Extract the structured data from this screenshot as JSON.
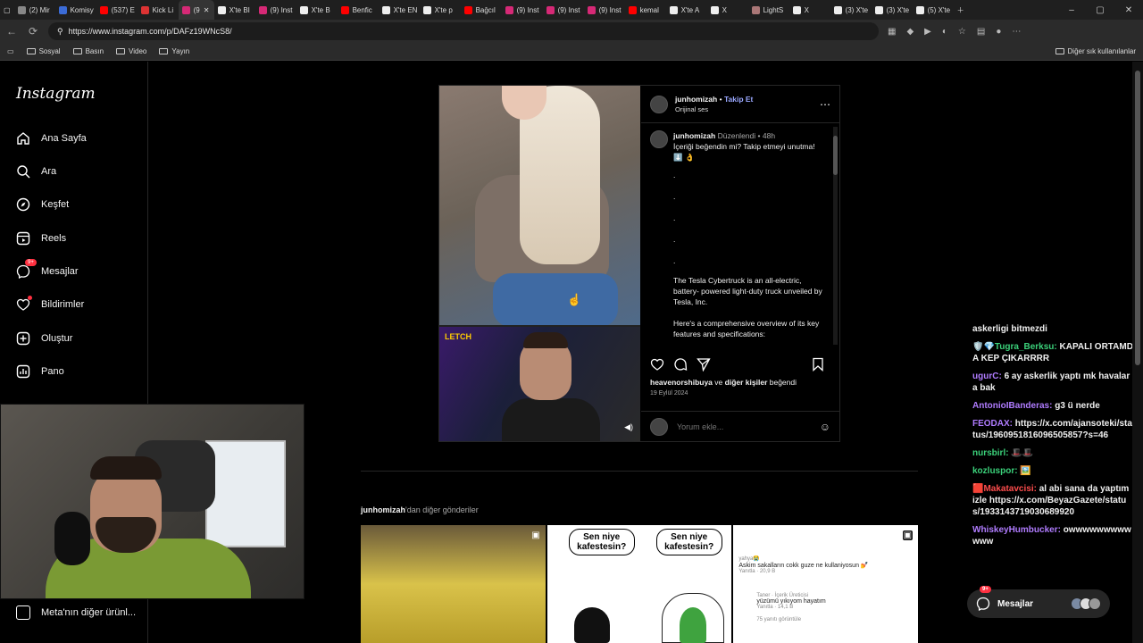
{
  "browser": {
    "tabs": [
      {
        "title": "(2) Mir",
        "color": "#888"
      },
      {
        "title": "Komisy",
        "color": "#3b6bd6"
      },
      {
        "title": "(537) E",
        "color": "#ff0000"
      },
      {
        "title": "Kick Li",
        "color": "#d33"
      },
      {
        "title": "(9",
        "color": "#d62976",
        "active": true
      },
      {
        "title": "X'te BI",
        "color": "#eee"
      },
      {
        "title": "(9) Inst",
        "color": "#d62976"
      },
      {
        "title": "X'te B",
        "color": "#eee"
      },
      {
        "title": "Benfic",
        "color": "#ff0000"
      },
      {
        "title": "X'te EN",
        "color": "#eee"
      },
      {
        "title": "X'te p",
        "color": "#eee"
      },
      {
        "title": "Bağcıl",
        "color": "#ff0000"
      },
      {
        "title": "(9) Inst",
        "color": "#d62976"
      },
      {
        "title": "(9) Inst",
        "color": "#d62976"
      },
      {
        "title": "(9) Inst",
        "color": "#d62976"
      },
      {
        "title": "kemal",
        "color": "#ff0000"
      },
      {
        "title": "X'te A",
        "color": "#eee"
      },
      {
        "title": "X",
        "color": "#eee"
      },
      {
        "title": "LightS",
        "color": "#a77"
      },
      {
        "title": "X",
        "color": "#eee"
      },
      {
        "title": "(3) X'te",
        "color": "#eee"
      },
      {
        "title": "(3) X'te",
        "color": "#eee"
      },
      {
        "title": "(5) X'te",
        "color": "#eee"
      }
    ],
    "url": "https://www.instagram.com/p/DAFz19WNcS8/",
    "bookmarks": [
      "Sosyal",
      "Basın",
      "Video",
      "Yayın"
    ],
    "bookmarks_right": "Diğer sık kullanılanlar"
  },
  "sidebar": {
    "logo": "Instagram",
    "items": [
      {
        "label": "Ana Sayfa",
        "icon": "home-icon"
      },
      {
        "label": "Ara",
        "icon": "search-icon"
      },
      {
        "label": "Keşfet",
        "icon": "compass-icon"
      },
      {
        "label": "Reels",
        "icon": "reels-icon"
      },
      {
        "label": "Mesajlar",
        "icon": "messenger-icon",
        "badge": "9+"
      },
      {
        "label": "Bildirimler",
        "icon": "heart-icon"
      },
      {
        "label": "Oluştur",
        "icon": "plus-square-icon"
      },
      {
        "label": "Pano",
        "icon": "dashboard-icon"
      }
    ],
    "meta_link": "Meta'nın diğer ürünl..."
  },
  "post": {
    "username": "junhomizah",
    "follow": "Takip Et",
    "audio": "Orijinal ses",
    "caption_meta_edited": "Düzenlendi",
    "caption_meta_age": "48h",
    "caption_text": "İçeriği beğendin mi? Takip etmeyi unutma! ⬇️ 👌",
    "dots": [
      ".",
      ".",
      ".",
      ".",
      "."
    ],
    "caption_p1": "The Tesla Cybertruck is an all-electric, battery- powered light-duty truck unveiled by Tesla, Inc.",
    "caption_p2": "Here's a comprehensive overview of its key features and specifications:",
    "likes_user": "heavenorshibuya",
    "likes_and": "ve",
    "likes_others": "diğer kişiler",
    "likes_suffix": "beğendi",
    "date": "19 Eylül 2024",
    "comment_placeholder": "Yorum ekle...",
    "video_watermark": "LETCH"
  },
  "more_posts": {
    "username": "junhomizah",
    "suffix": "'dan diğer gönderiler",
    "bubble1": "Sen niye kafestesin?",
    "bubble2": "Sen niye kafestesin?",
    "comment1_user": "yahya😭",
    "comment1_text": "Askim sakalların cokk guze ne kullaniyosun 💅",
    "comment1_likes": "20,9 B",
    "comment_reply": "Yanıtla",
    "comment2_user": "Taner · İçerik Üreticisi",
    "comment2_text": "yüzümü yıkıyom hayatım",
    "comment2_likes": "14,1 B",
    "comment_more": "75 yanıtı görüntüle"
  },
  "chat": [
    {
      "user": "",
      "text": "askerligi bitmezdi",
      "color": "#f0f0f0"
    },
    {
      "user": "🛡️💎Tugra_Berksu:",
      "text": "KAPALI ORTAMDA KEP ÇIKARRRR",
      "color": "#3bd17a"
    },
    {
      "user": "ugurC:",
      "text": "6 ay askerlik yaptı mk havalara bak",
      "color": "#b07cff"
    },
    {
      "user": "AntonioIBanderas:",
      "text": "g3 ü nerde",
      "color": "#b07cff"
    },
    {
      "user": "FEODAX:",
      "text": "https://x.com/ajansoteki/status/1960951816096505857?s=46",
      "color": "#b07cff"
    },
    {
      "user": "nursbirl:",
      "text": "🎩🎩",
      "color": "#3bd17a"
    },
    {
      "user": "kozluspor:",
      "text": "🖼️",
      "color": "#3bd17a"
    },
    {
      "user": "🟥Makatavcisi:",
      "text": "al abi sana da yaptım izle https://x.com/BeyazGazete/status/1933143719030689920",
      "color": "#ff4d4d"
    },
    {
      "user": "WhiskeyHumbucker:",
      "text": "owwwwwwwwwwww",
      "color": "#b07cff"
    }
  ],
  "messages_pill": {
    "label": "Mesajlar",
    "badge": "9+"
  },
  "colors": {
    "accent": "#0095f6",
    "follow": "#9aa8ff",
    "badge": "#ff3040"
  }
}
